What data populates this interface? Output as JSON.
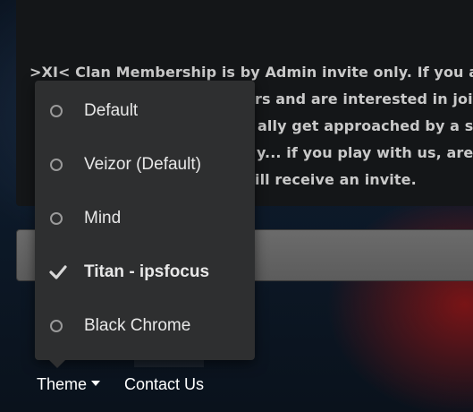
{
  "notice": {
    "line1": ">XI< Clan Membership is by Admin invite only. If you a",
    "line2": "rs and are interested in joi",
    "line3": "ally get approached by a se",
    "line4": "y... if you play with us, are",
    "line5": "ill receive an invite."
  },
  "theme_menu": {
    "items": [
      {
        "label": "Default",
        "selected": false
      },
      {
        "label": "Veizor (Default)",
        "selected": false
      },
      {
        "label": "Mind",
        "selected": false
      },
      {
        "label": "Titan - ipsfocus",
        "selected": true
      },
      {
        "label": "Black Chrome",
        "selected": false
      }
    ]
  },
  "footer": {
    "theme_label": "Theme",
    "contact_label": "Contact Us"
  },
  "colors": {
    "menu_bg": "#2e2f30",
    "logo_red": "#c0161c",
    "text_light": "#e8e8e8"
  }
}
